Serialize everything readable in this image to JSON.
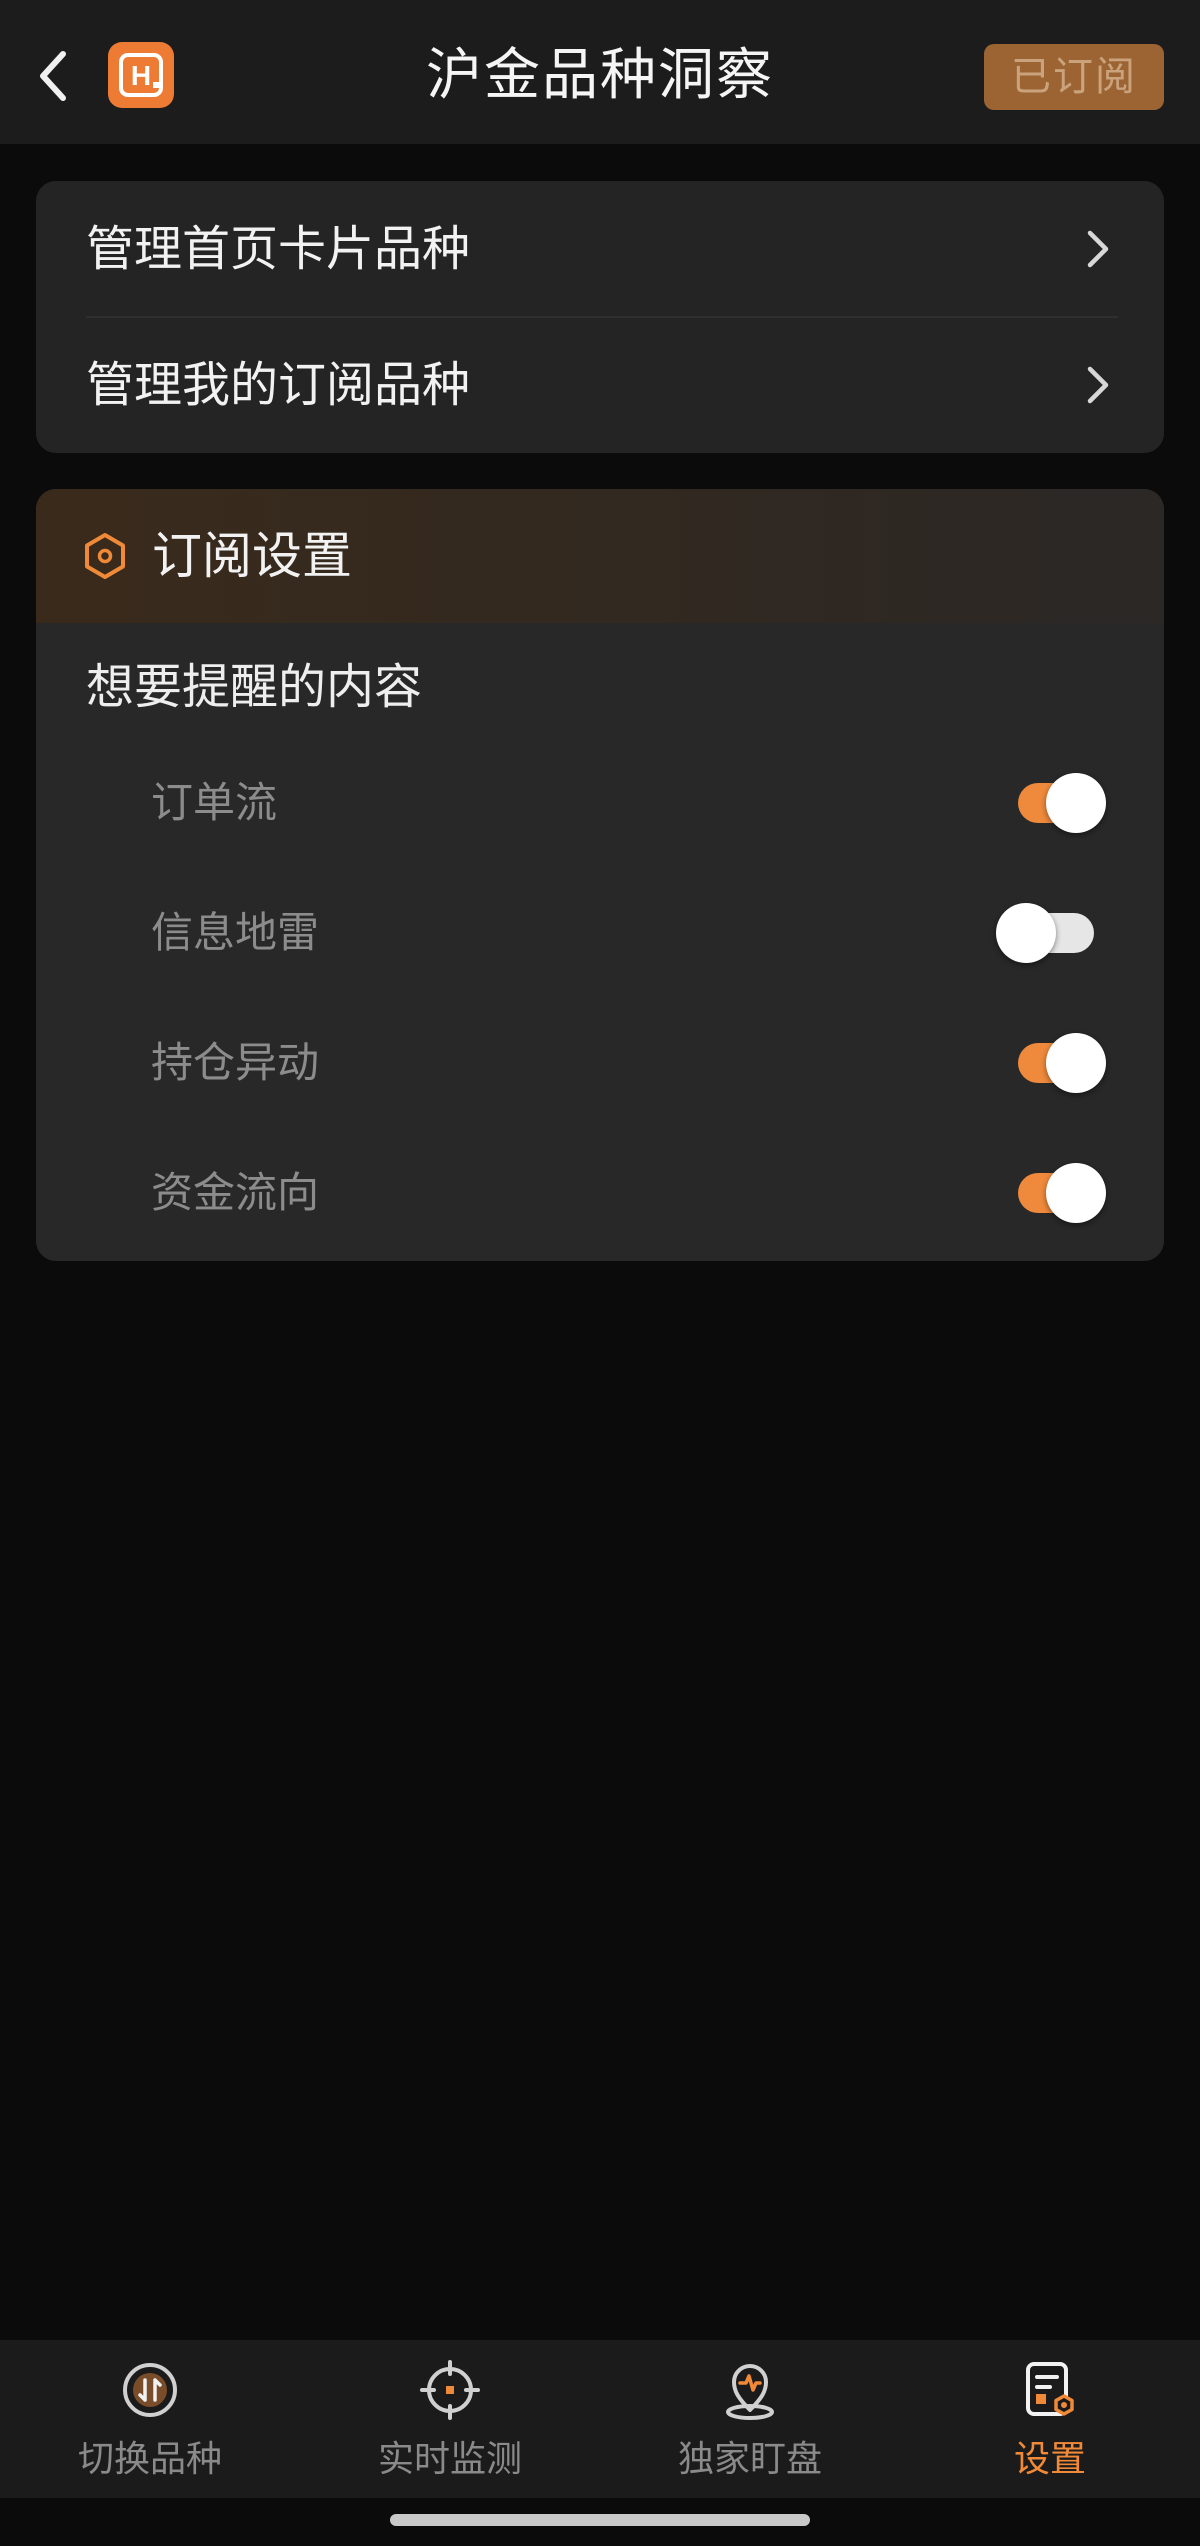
{
  "header": {
    "title": "沪金品种洞察",
    "logo_text": "H",
    "subscribed_label": "已订阅"
  },
  "menu": {
    "items": [
      {
        "label": "管理首页卡片品种",
        "icon": "chevron-right-icon"
      },
      {
        "label": "管理我的订阅品种",
        "icon": "chevron-right-icon"
      }
    ]
  },
  "subscription": {
    "title": "订阅设置",
    "icon": "hexagon-settings-icon",
    "section_label": "想要提醒的内容",
    "toggles": [
      {
        "label": "订单流",
        "on": true
      },
      {
        "label": "信息地雷",
        "on": false
      },
      {
        "label": "持仓异动",
        "on": true
      },
      {
        "label": "资金流向",
        "on": true
      }
    ]
  },
  "nav": {
    "items": [
      {
        "label": "切换品种",
        "icon": "switch-variety-icon",
        "active": false
      },
      {
        "label": "实时监测",
        "icon": "crosshair-icon",
        "active": false
      },
      {
        "label": "独家盯盘",
        "icon": "location-pin-icon",
        "active": false
      },
      {
        "label": "设置",
        "icon": "settings-document-icon",
        "active": true
      }
    ]
  },
  "colors": {
    "accent": "#ef8a3c",
    "header_bg": "#1c1c1c",
    "card_bg": "#242424",
    "page_bg": "#0b0b0b",
    "subscribed_btn_bg": "#9b6432"
  }
}
